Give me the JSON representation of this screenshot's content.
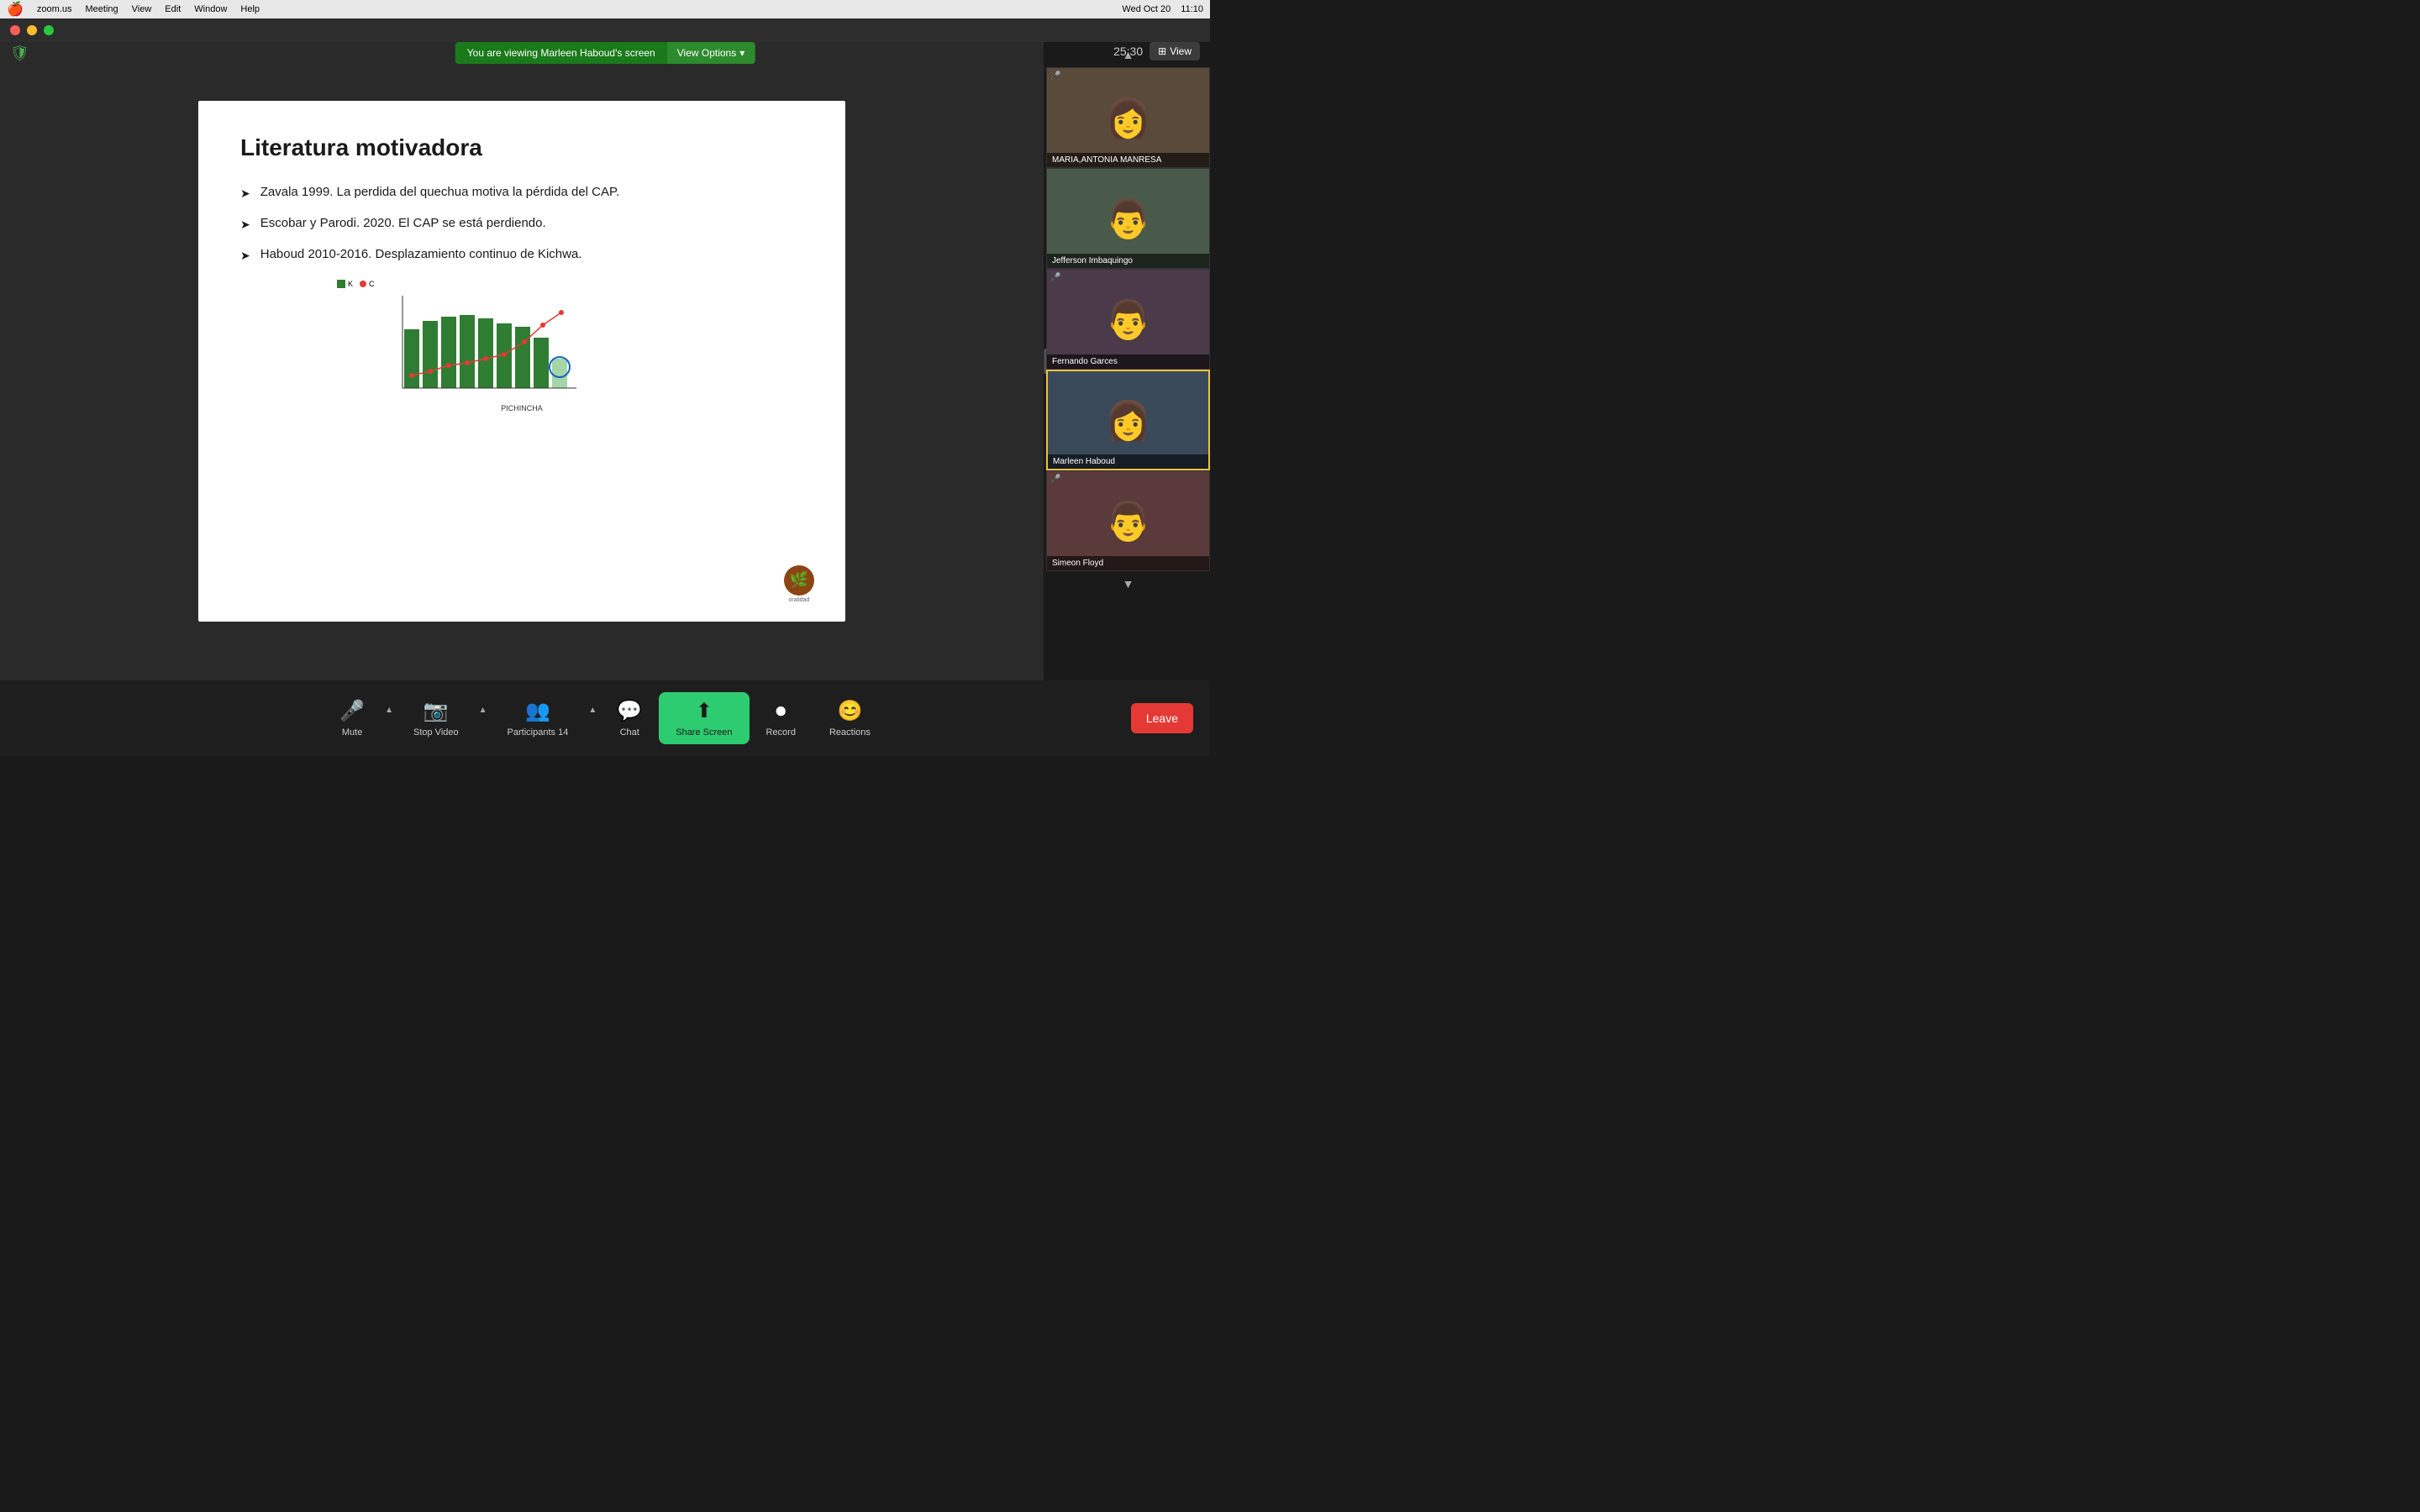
{
  "menubar": {
    "apple": "🍎",
    "items": [
      "zoom.us",
      "Meeting",
      "View",
      "Edit",
      "Window",
      "Help"
    ],
    "right_items": [
      "Wed Oct 20",
      "11:10"
    ]
  },
  "window": {
    "traffic_lights": [
      "red",
      "yellow",
      "green"
    ]
  },
  "notification_bar": {
    "message": "You are viewing Marleen Haboud's screen",
    "view_options_label": "View Options",
    "view_options_arrow": "▾"
  },
  "top_right": {
    "timer": "25:30",
    "view_label": "View",
    "view_icon": "⊞"
  },
  "slide": {
    "title": "Literatura motivadora",
    "bullets": [
      "Zavala 1999. La perdida del quechua motiva la pérdida del CAP.",
      "Escobar y Parodi.  2020. El CAP se está perdiendo.",
      "Haboud 2010-2016. Desplazamiento continuo de Kichwa."
    ],
    "chart_legend": {
      "k_label": "K",
      "c_label": "C"
    },
    "chart_place_label": "PICHINCHA",
    "logo_text": "oralidad"
  },
  "participants": [
    {
      "name": "MARIA,ANTONIA MANRESA",
      "has_mic_off": true,
      "active": false
    },
    {
      "name": "Jefferson Imbaquingo",
      "has_mic_off": false,
      "active": false
    },
    {
      "name": "Fernando Garces",
      "has_mic_off": true,
      "active": false
    },
    {
      "name": "Marleen Haboud",
      "has_mic_off": false,
      "active": true
    },
    {
      "name": "Simeon Floyd",
      "has_mic_off": true,
      "active": false
    }
  ],
  "toolbar": {
    "mute_label": "Mute",
    "video_label": "Stop Video",
    "participants_label": "Participants",
    "participants_count": "14",
    "chat_label": "Chat",
    "share_screen_label": "Share Screen",
    "record_label": "Record",
    "reactions_label": "Reactions",
    "leave_label": "Leave"
  }
}
